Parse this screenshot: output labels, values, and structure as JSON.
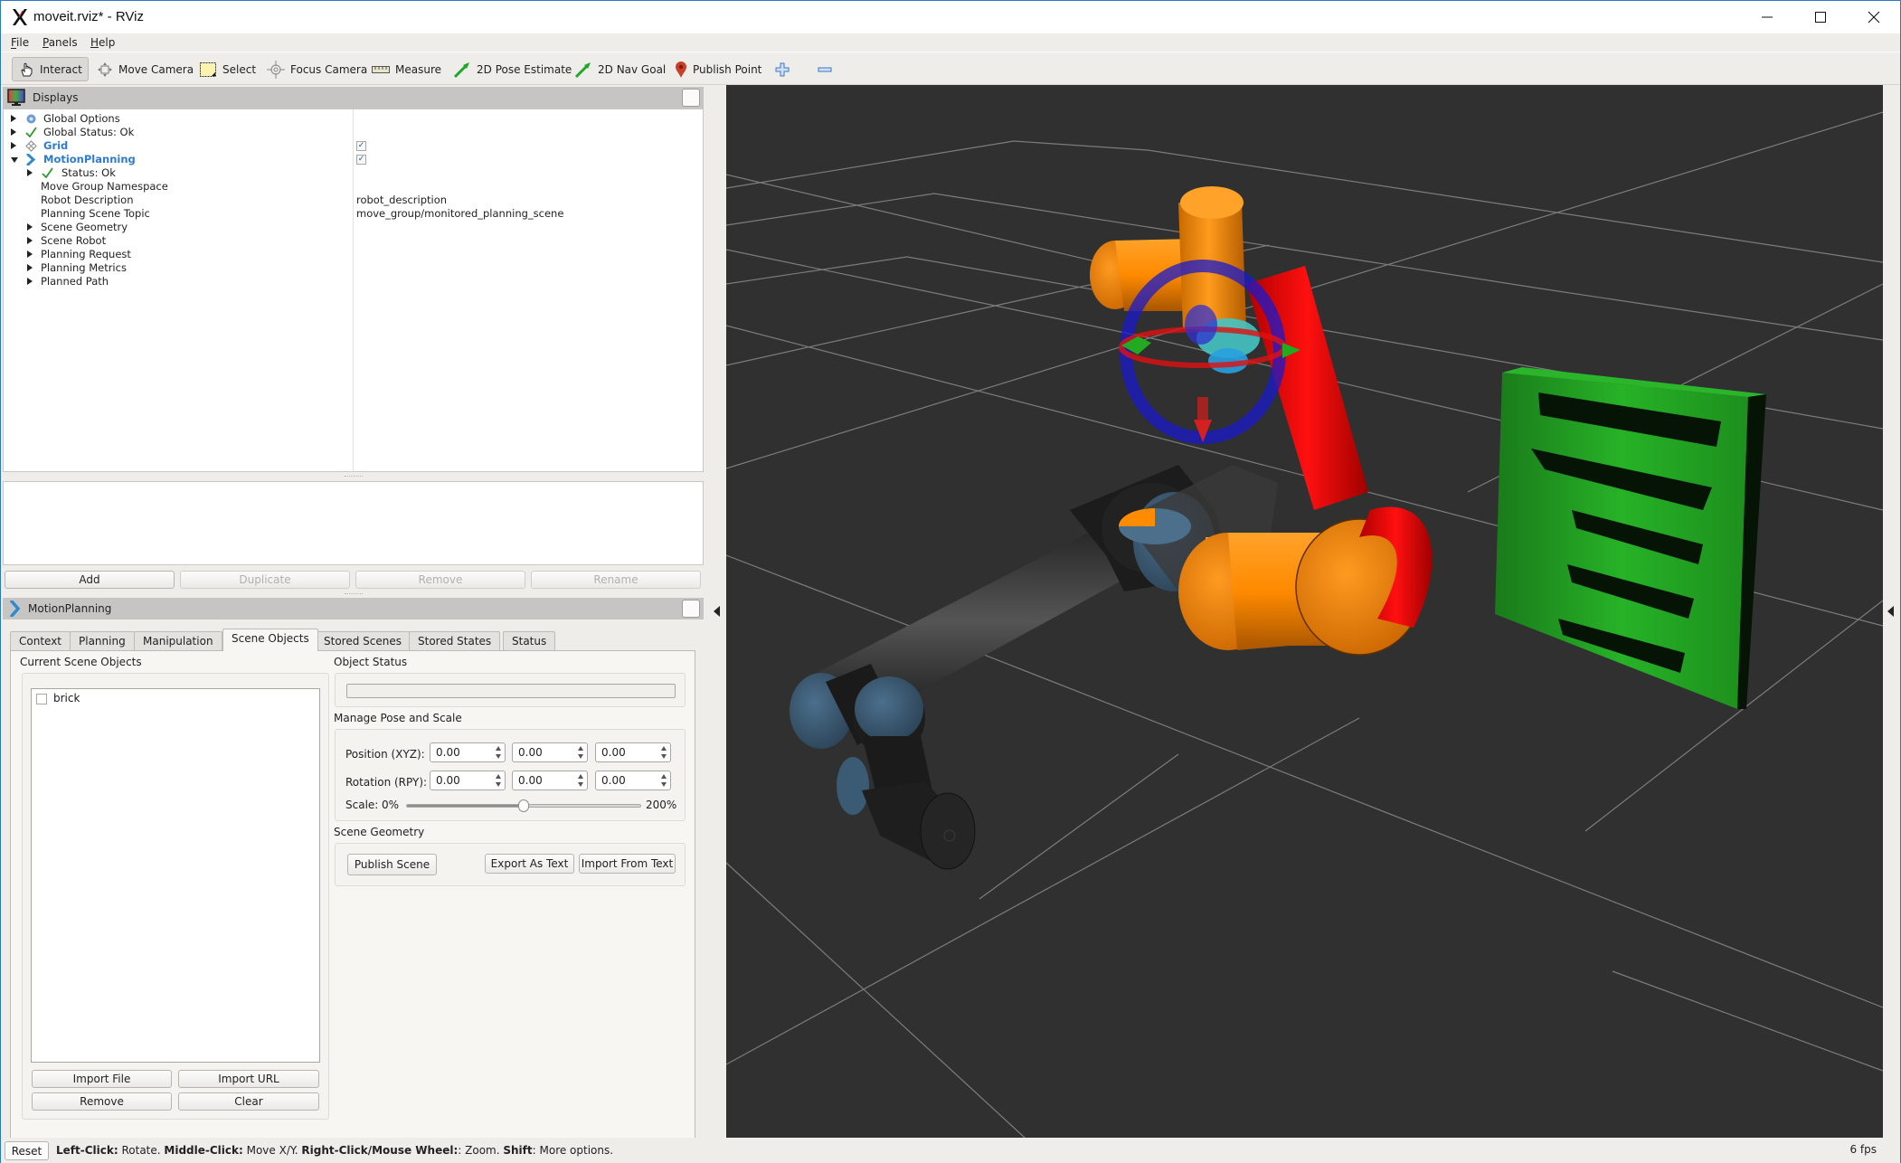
{
  "window": {
    "title": "moveit.rviz* - RViz",
    "controls": {
      "minimize": "minimize",
      "maximize": "maximize",
      "close": "close"
    }
  },
  "menu": {
    "items": [
      {
        "label": "File",
        "mnemonic": "F"
      },
      {
        "label": "Panels",
        "mnemonic": "P"
      },
      {
        "label": "Help",
        "mnemonic": "H"
      }
    ]
  },
  "toolbar": {
    "tools": [
      {
        "label": "Interact",
        "icon": "hand-pointer-icon",
        "active": true
      },
      {
        "label": "Move Camera",
        "icon": "move-camera-icon",
        "active": false
      },
      {
        "label": "Select",
        "icon": "select-box-icon",
        "active": false
      },
      {
        "label": "Focus Camera",
        "icon": "focus-camera-icon",
        "active": false
      },
      {
        "label": "Measure",
        "icon": "ruler-icon",
        "active": false
      },
      {
        "label": "2D Pose Estimate",
        "icon": "green-arrow-icon",
        "active": false
      },
      {
        "label": "2D Nav Goal",
        "icon": "green-arrow-icon",
        "active": false
      },
      {
        "label": "Publish Point",
        "icon": "map-pin-icon",
        "active": false
      }
    ],
    "add_tool": "plus-icon",
    "remove_tool": "minus-icon"
  },
  "displays_panel": {
    "title": "Displays",
    "tree": [
      {
        "label": "Global Options",
        "icon": "gear-icon",
        "expand": "collapsed",
        "indent": 0,
        "value": ""
      },
      {
        "label": "Global Status: Ok",
        "icon": "check-icon",
        "expand": "collapsed",
        "indent": 0,
        "value": ""
      },
      {
        "label": "Grid",
        "icon": "grid-icon",
        "expand": "collapsed",
        "indent": 0,
        "bold": true,
        "checked": true
      },
      {
        "label": "MotionPlanning",
        "icon": "motion-planning-icon",
        "expand": "expanded",
        "indent": 0,
        "bold": true,
        "checked": true
      },
      {
        "label": "Status: Ok",
        "icon": "check-icon",
        "expand": "collapsed",
        "indent": 1,
        "value": ""
      },
      {
        "label": "Move Group Namespace",
        "expand": "none",
        "indent": 1,
        "value": ""
      },
      {
        "label": "Robot Description",
        "expand": "none",
        "indent": 1,
        "value": "robot_description"
      },
      {
        "label": "Planning Scene Topic",
        "expand": "none",
        "indent": 1,
        "value": "move_group/monitored_planning_scene"
      },
      {
        "label": "Scene Geometry",
        "expand": "collapsed",
        "indent": 1,
        "value": ""
      },
      {
        "label": "Scene Robot",
        "expand": "collapsed",
        "indent": 1,
        "value": ""
      },
      {
        "label": "Planning Request",
        "expand": "collapsed",
        "indent": 1,
        "value": ""
      },
      {
        "label": "Planning Metrics",
        "expand": "collapsed",
        "indent": 1,
        "value": ""
      },
      {
        "label": "Planned Path",
        "expand": "collapsed",
        "indent": 1,
        "value": ""
      }
    ],
    "buttons": {
      "add": "Add",
      "duplicate": "Duplicate",
      "remove": "Remove",
      "rename": "Rename"
    }
  },
  "motion_planning_panel": {
    "title": "MotionPlanning",
    "tabs": [
      {
        "label": "Context",
        "active": false
      },
      {
        "label": "Planning",
        "active": false
      },
      {
        "label": "Manipulation",
        "active": false
      },
      {
        "label": "Scene Objects",
        "active": true
      },
      {
        "label": "Stored Scenes",
        "active": false
      },
      {
        "label": "Stored States",
        "active": false
      },
      {
        "label": "Status",
        "active": false
      }
    ],
    "scene_objects": {
      "current_objects_title": "Current Scene Objects",
      "objects": [
        {
          "name": "brick",
          "checked": false
        }
      ],
      "buttons": {
        "import_file": "Import File",
        "import_url": "Import URL",
        "remove": "Remove",
        "clear": "Clear"
      },
      "object_status_title": "Object Status",
      "object_status_value": "",
      "pose_title": "Manage Pose and Scale",
      "position_label": "Position (XYZ):",
      "position": [
        "0.00",
        "0.00",
        "0.00"
      ],
      "rotation_label": "Rotation (RPY):",
      "rotation": [
        "0.00",
        "0.00",
        "0.00"
      ],
      "scale_label": "Scale:",
      "scale_min": "0%",
      "scale_max": "200%",
      "scale_value_percent": 100,
      "scene_geometry_title": "Scene Geometry",
      "publish_scene": "Publish Scene",
      "export_as_text": "Export As Text",
      "import_from_text": "Import From Text"
    }
  },
  "viewport": {
    "scene": "3D render: grid floor, robot arm (orange/red highlighted goal state with interactive marker, dark grey current state), green shelf obstacle",
    "background_color": "#303030",
    "goal_color": "#ff8c00",
    "collision_color": "#e00000",
    "shelf_color": "#22a022"
  },
  "statusbar": {
    "reset": "Reset",
    "hint": [
      {
        "text": "Left-Click:",
        "bold": true
      },
      {
        "text": " Rotate. ",
        "bold": false
      },
      {
        "text": "Middle-Click:",
        "bold": true
      },
      {
        "text": " Move X/Y. ",
        "bold": false
      },
      {
        "text": "Right-Click/Mouse Wheel:",
        "bold": true
      },
      {
        "text": ": Zoom. ",
        "bold": false
      },
      {
        "text": "Shift",
        "bold": true
      },
      {
        "text": ": More options.",
        "bold": false
      }
    ],
    "fps": "6 fps"
  }
}
